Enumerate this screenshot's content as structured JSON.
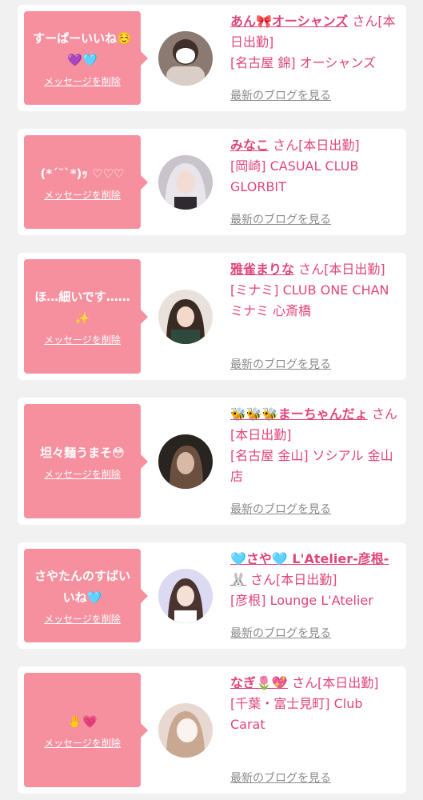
{
  "delete_label": "メッセージを削除",
  "blog_label": "最新のブログを見る",
  "san_suffix": "さん",
  "colors": {
    "bubble": "#f6909f",
    "name": "#e0457a",
    "blog": "#8a8a8a",
    "background": "#f1f1f1"
  },
  "cards": [
    {
      "message": "すーぱーいいね☺️💜🩵",
      "name": "あん🎀オーシャンズ",
      "status": "[本日出勤]",
      "shop": "[名古屋 錦] オーシャンズ"
    },
    {
      "message": "(*´˘`*)ｯ ♡♡♡",
      "name": "みなこ",
      "status": "[本日出勤]",
      "shop": "[岡崎] CASUAL CLUB GLORBIT"
    },
    {
      "message": "ほ…細いです……✨",
      "name": "雅雀まりな",
      "status": "[本日出勤]",
      "shop": "[ミナミ] CLUB ONE CHAN ミナミ 心斎橋"
    },
    {
      "message": "坦々麺うまそ😳",
      "name": "🐝🐝🐝まーちゃんだょ",
      "status": "[本日出勤]",
      "shop": "[名古屋 金山] ソシアル 金山店"
    },
    {
      "message": "さやたんのすばいいね🩵",
      "name": "🩵さや🩵 L'Atelier-彦根-🐰",
      "status": "[本日出勤]",
      "shop": "[彦根] Lounge L'Atelier"
    },
    {
      "message": "🤚💗",
      "name": "なぎ🌷💖",
      "status": "[本日出勤]",
      "shop": "[千葉・富士見町] Club Carat"
    }
  ]
}
